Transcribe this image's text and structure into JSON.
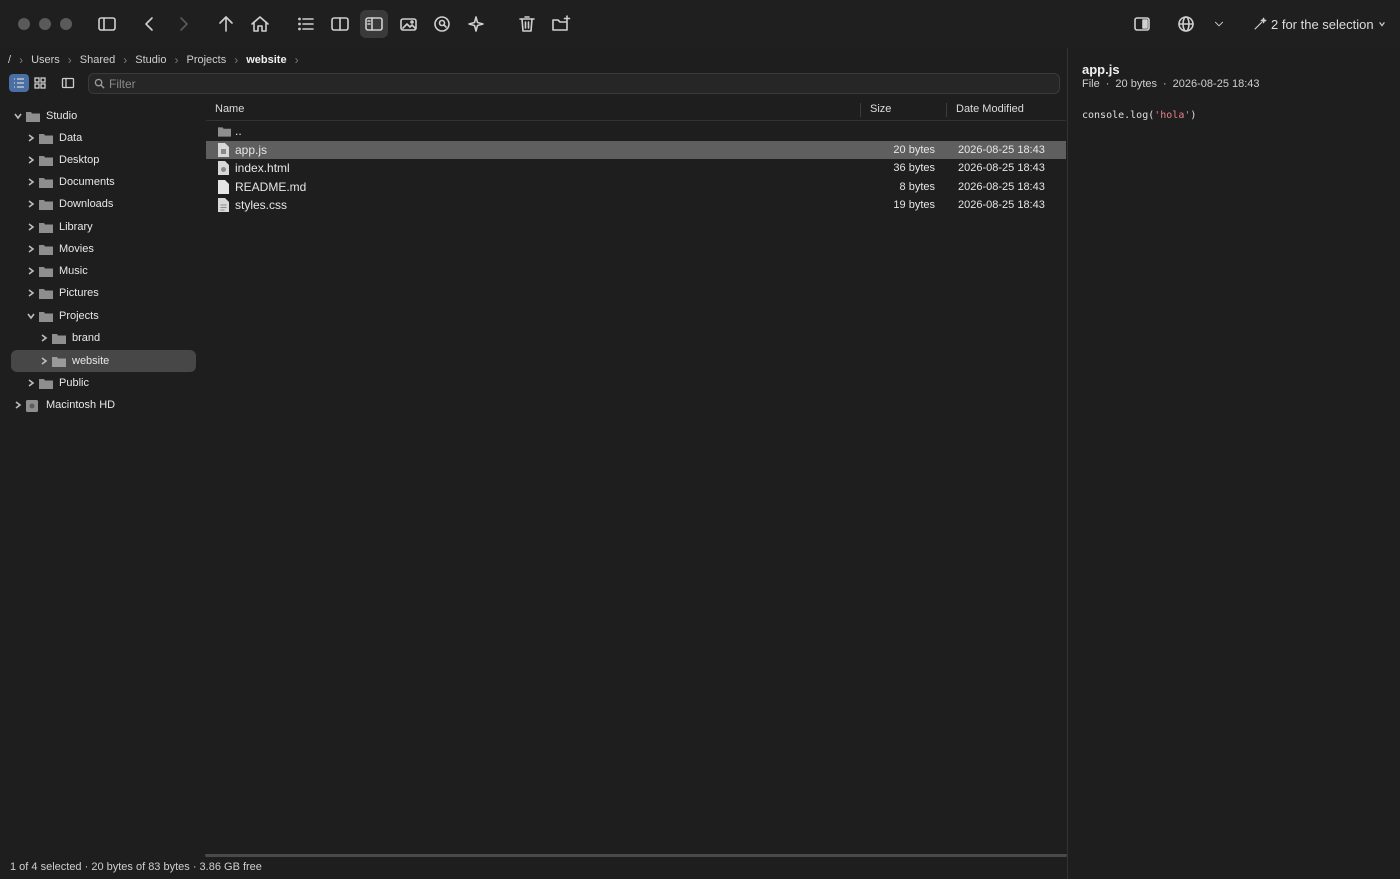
{
  "toolbar": {
    "selection_label": "2 for the selection"
  },
  "breadcrumb": [
    "/",
    "Users",
    "Shared",
    "Studio",
    "Projects",
    "website"
  ],
  "filter": {
    "placeholder": "Filter",
    "value": ""
  },
  "sidebar": {
    "items": [
      {
        "label": "Studio",
        "expanded": true
      },
      {
        "label": "Data"
      },
      {
        "label": "Desktop"
      },
      {
        "label": "Documents"
      },
      {
        "label": "Downloads"
      },
      {
        "label": "Library"
      },
      {
        "label": "Movies"
      },
      {
        "label": "Music"
      },
      {
        "label": "Pictures"
      },
      {
        "label": "Projects",
        "expanded": true
      },
      {
        "label": "brand"
      },
      {
        "label": "website",
        "selected": true
      },
      {
        "label": "Public"
      },
      {
        "label": "Macintosh HD"
      }
    ]
  },
  "columns": {
    "name": "Name",
    "size": "Size",
    "date": "Date Modified"
  },
  "files": [
    {
      "name": "..",
      "size": "",
      "date": "",
      "type": "folder"
    },
    {
      "name": "app.js",
      "size": "20 bytes",
      "date": "2026-08-25 18:43",
      "selected": true
    },
    {
      "name": "index.html",
      "size": "36 bytes",
      "date": "2026-08-25 18:43"
    },
    {
      "name": "README.md",
      "size": "8 bytes",
      "date": "2026-08-25 18:43"
    },
    {
      "name": "styles.css",
      "size": "19 bytes",
      "date": "2026-08-25 18:43"
    }
  ],
  "status": "1 of 4 selected · 20 bytes of 83 bytes · 3.86 GB free",
  "preview": {
    "name": "app.js",
    "kind": "File",
    "size": "20 bytes",
    "date": "2026-08-25 18:43",
    "code_prefix": "console.log(",
    "code_string": "'hola'",
    "code_suffix": ")"
  }
}
